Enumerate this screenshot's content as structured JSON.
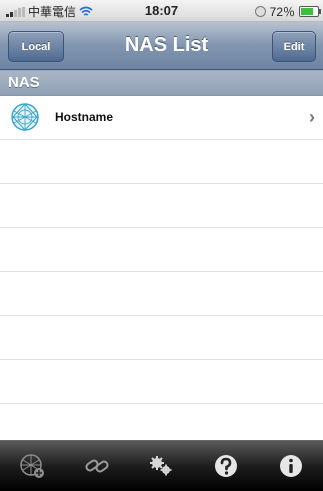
{
  "status_bar": {
    "carrier": "中華電信",
    "time": "18:07",
    "battery_text": "72％",
    "battery_level": 0.72
  },
  "nav": {
    "left_button": "Local",
    "title": "NAS List",
    "right_button": "Edit"
  },
  "section": {
    "header": "NAS"
  },
  "list": {
    "items": [
      {
        "label": "Hostname",
        "icon": "globe-network-icon"
      }
    ],
    "empty_rows": 7
  },
  "tabbar": {
    "items": [
      {
        "icon": "add-nas-globe-icon"
      },
      {
        "icon": "link-icon"
      },
      {
        "icon": "settings-gears-icon"
      },
      {
        "icon": "help-icon"
      },
      {
        "icon": "info-icon"
      }
    ]
  },
  "colors": {
    "nav_bar": "#7d92ae",
    "battery_fill": "#3cbf3c",
    "accent_globe": "#3aa7c7"
  }
}
